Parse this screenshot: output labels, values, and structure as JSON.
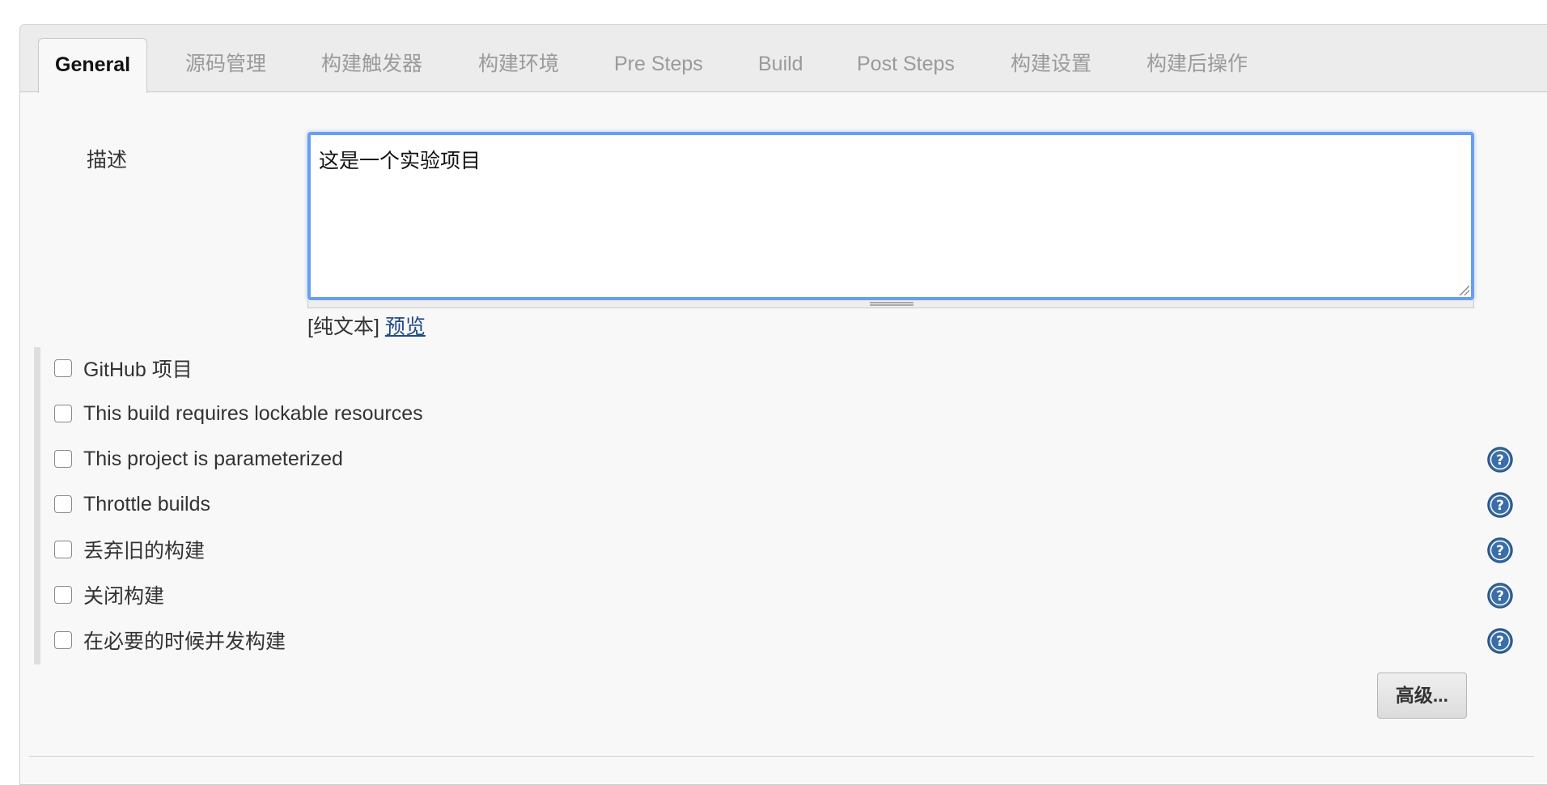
{
  "tabs": [
    {
      "label": "General",
      "active": true
    },
    {
      "label": "源码管理",
      "active": false
    },
    {
      "label": "构建触发器",
      "active": false
    },
    {
      "label": "构建环境",
      "active": false
    },
    {
      "label": "Pre Steps",
      "active": false
    },
    {
      "label": "Build",
      "active": false
    },
    {
      "label": "Post Steps",
      "active": false
    },
    {
      "label": "构建设置",
      "active": false
    },
    {
      "label": "构建后操作",
      "active": false
    }
  ],
  "description": {
    "label": "描述",
    "value": "这是一个实验项目",
    "format_prefix": "[纯文本]",
    "preview_link": "预览"
  },
  "options": [
    {
      "label": "GitHub 项目",
      "checked": false,
      "has_help": false
    },
    {
      "label": "This build requires lockable resources",
      "checked": false,
      "has_help": false
    },
    {
      "label": "This project is parameterized",
      "checked": false,
      "has_help": true
    },
    {
      "label": "Throttle builds",
      "checked": false,
      "has_help": true
    },
    {
      "label": "丢弃旧的构建",
      "checked": false,
      "has_help": true
    },
    {
      "label": "关闭构建",
      "checked": false,
      "has_help": true
    },
    {
      "label": "在必要的时候并发构建",
      "checked": false,
      "has_help": true
    }
  ],
  "advanced_button": "高级...",
  "colors": {
    "focus_border": "#6a9ef0",
    "link": "#204a87",
    "help_icon": "#3b6ea8"
  }
}
